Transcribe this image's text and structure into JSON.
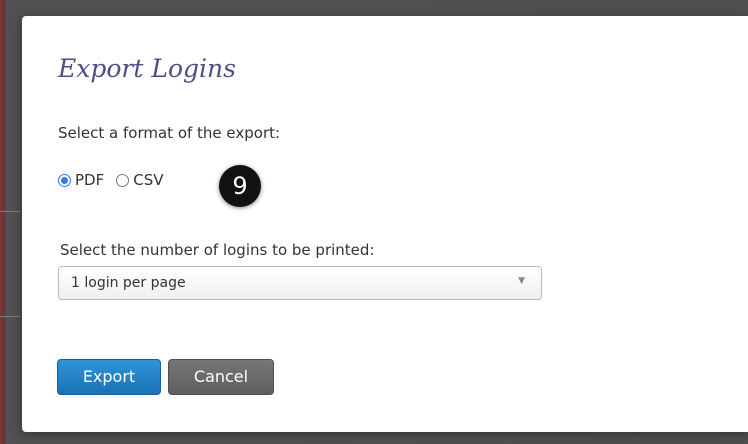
{
  "dialog": {
    "title": "Export Logins",
    "format_label": "Select a format of the export:",
    "formats": [
      {
        "label": "PDF",
        "selected": true
      },
      {
        "label": "CSV",
        "selected": false
      }
    ],
    "step_badge": "9",
    "number_label": "Select the number of logins to be printed:",
    "logins_select": {
      "value": "1 login per page",
      "caret": "▼"
    },
    "buttons": {
      "export": "Export",
      "cancel": "Cancel"
    }
  },
  "colors": {
    "title": "#4b4f86",
    "export_button": "#1f7fc4",
    "cancel_button": "#6a6a6a",
    "radio_accent": "#2d7ee6",
    "step_badge": "#111111"
  }
}
